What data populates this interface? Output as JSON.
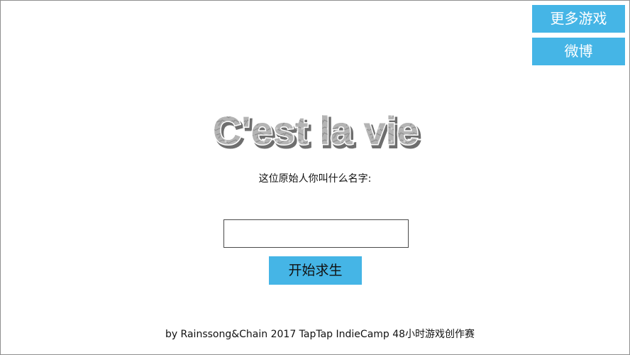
{
  "top_buttons": {
    "more_games": "更多游戏",
    "weibo": "微博"
  },
  "title": "C'est la vie",
  "prompt": "这位原始人你叫什么名字:",
  "name_input": {
    "value": "",
    "placeholder": ""
  },
  "start_button": "开始求生",
  "credit": "by Rainssong&Chain 2017 TapTap IndieCamp 48小时游戏创作赛",
  "colors": {
    "button_bg": "#45b5e6",
    "title_fill": "#a9a9a9",
    "title_outline": "#ffffff",
    "title_shadow": "#6e6e6e"
  }
}
